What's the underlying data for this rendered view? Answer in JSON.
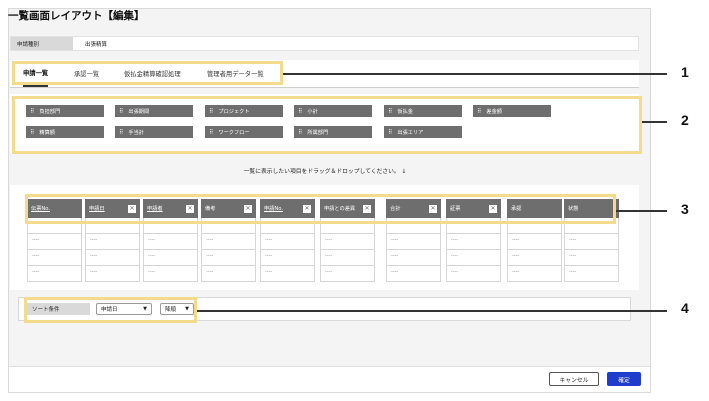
{
  "title": "一覧画面レイアウト【編集】",
  "meta": {
    "label": "申請種別",
    "value": "出張精算"
  },
  "tabs": [
    "申請一覧",
    "承認一覧",
    "仮払金精算確認処理",
    "管理者用データ一覧"
  ],
  "active_tab": 0,
  "available_fields": [
    "負担部門",
    "出張期間",
    "プロジェクト",
    "小計",
    "仮払金",
    "差金額",
    "精算額",
    "手当計",
    "ワークフロー",
    "所属部門",
    "出張エリア"
  ],
  "drag_hint": "一覧に表示したい項目をドラッグ＆ドロップしてください。 ↓",
  "table_columns": [
    {
      "label": "伝票No.",
      "removable": false,
      "link": true
    },
    {
      "label": "申請日",
      "removable": true,
      "link": true
    },
    {
      "label": "申請者",
      "removable": true,
      "link": true
    },
    {
      "label": "備考",
      "removable": true,
      "link": false
    },
    {
      "label": "申請No.",
      "removable": true,
      "link": true
    },
    {
      "label": "申請との差異",
      "removable": true,
      "link": false
    },
    {
      "label": "合計",
      "removable": true,
      "link": false
    },
    {
      "label": "証票",
      "removable": true,
      "link": false
    },
    {
      "label": "承認",
      "removable": false,
      "link": false
    },
    {
      "label": "状態",
      "removable": false,
      "link": false
    }
  ],
  "cell_placeholder": "----",
  "row_count": 4,
  "close_glyph": "✕",
  "sort": {
    "label": "ソート条件",
    "field_value": "申請日",
    "order_value": "降順"
  },
  "footer": {
    "cancel_label": "キャンセル",
    "ok_label": "確定"
  },
  "callouts": [
    "1",
    "2",
    "3",
    "4"
  ],
  "colors": {
    "chip": "#6e6e6e",
    "primary": "#1f3ccc",
    "highlight": "#f2dc8c"
  }
}
